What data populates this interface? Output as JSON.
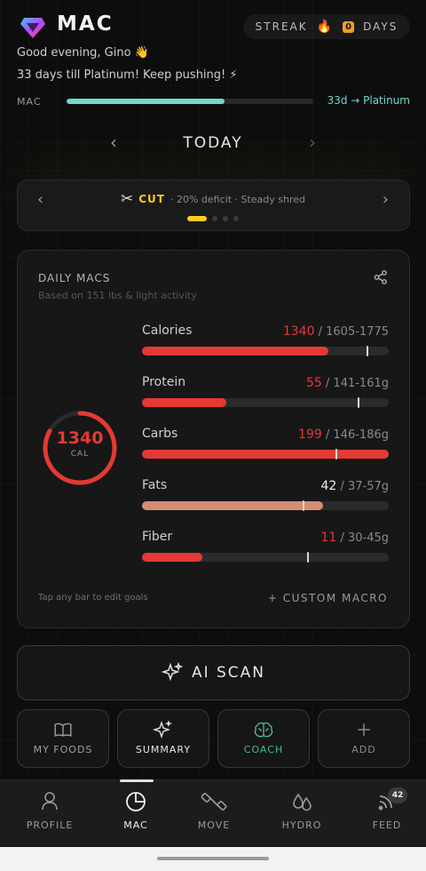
{
  "header": {
    "app_title": "MAC",
    "streak_label": "STREAK",
    "streak_count": "0",
    "streak_unit": "DAYS",
    "greeting": "Good evening, Gino 👋",
    "platinum_message": "33 days till Platinum! Keep pushing! ⚡"
  },
  "progress": {
    "label": "MAC",
    "right_text": "33d → Platinum",
    "fill_fraction": 0.64,
    "color": "#74d7cc"
  },
  "date_nav": {
    "label": "TODAY"
  },
  "phase": {
    "name": "CUT",
    "description": "· 20% deficit · Steady shred",
    "active_dot": 0,
    "dot_count": 4
  },
  "macros": {
    "title": "DAILY MACS",
    "subtitle": "Based on 151 lbs & light activity",
    "ring": {
      "value": "1340",
      "unit": "CAL",
      "fraction": 0.83
    },
    "items": [
      {
        "name": "Calories",
        "current": "1340",
        "goal": "1605-1775",
        "fill": 0.755,
        "marker": 0.91,
        "color": "#e53935",
        "value_color": "#e53935"
      },
      {
        "name": "Protein",
        "current": "55",
        "goal": "141-161g",
        "fill": 0.34,
        "marker": 0.875,
        "color": "#e53935",
        "value_color": "#e53935"
      },
      {
        "name": "Carbs",
        "current": "199",
        "goal": "146-186g",
        "fill": 1.0,
        "marker": 0.785,
        "color": "#e53935",
        "value_color": "#e53935"
      },
      {
        "name": "Fats",
        "current": "42",
        "goal": "37-57g",
        "fill": 0.735,
        "marker": 0.65,
        "color": "#d58c72",
        "value_color": "#eeeeee"
      },
      {
        "name": "Fiber",
        "current": "11",
        "goal": "30-45g",
        "fill": 0.245,
        "marker": 0.67,
        "color": "#e53935",
        "value_color": "#e53935"
      }
    ],
    "tap_hint": "Tap any bar to edit goals",
    "custom_macro_label": "+ CUSTOM MACRO"
  },
  "actions": {
    "ai_scan": "AI SCAN",
    "buttons": [
      {
        "label": "MY FOODS",
        "icon": "book-icon",
        "color": "#a0a0a0"
      },
      {
        "label": "SUMMARY",
        "icon": "sparkle-icon",
        "color": "#e6e6e6"
      },
      {
        "label": "COACH",
        "icon": "brain-icon",
        "color": "#4fb898"
      },
      {
        "label": "ADD",
        "icon": "plus-icon",
        "color": "#8a8a8a"
      }
    ]
  },
  "nav": {
    "items": [
      {
        "label": "PROFILE",
        "icon": "profile-icon"
      },
      {
        "label": "MAC",
        "icon": "pie-chart-icon",
        "active": true
      },
      {
        "label": "MOVE",
        "icon": "dumbbell-icon"
      },
      {
        "label": "HYDRO",
        "icon": "droplets-icon"
      },
      {
        "label": "FEED",
        "icon": "rss-icon"
      }
    ],
    "feed_badge": "42"
  }
}
